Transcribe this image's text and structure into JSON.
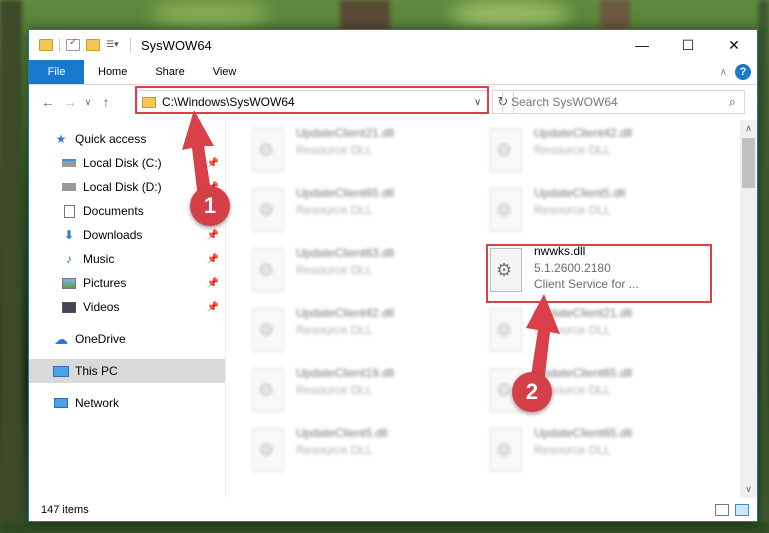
{
  "window": {
    "title": "SysWOW64",
    "controls": {
      "minimize": "—",
      "maximize": "☐",
      "close": "✕"
    }
  },
  "ribbon": {
    "file_tab": "File",
    "tabs": [
      "Home",
      "Share",
      "View"
    ],
    "help": "?"
  },
  "nav": {
    "back": "←",
    "forward": "→",
    "recent": "∨",
    "up": "↑",
    "address": "C:\\Windows\\SysWOW64",
    "search_placeholder": "Search SysWOW64"
  },
  "sidebar": {
    "items": [
      {
        "label": "Quick access",
        "icon": "star-icon",
        "pinned": false
      },
      {
        "label": "Local Disk (C:)",
        "icon": "drive-icon",
        "pinned": true
      },
      {
        "label": "Local Disk (D:)",
        "icon": "drive-icon",
        "pinned": true
      },
      {
        "label": "Documents",
        "icon": "document-icon",
        "pinned": true
      },
      {
        "label": "Downloads",
        "icon": "download-icon",
        "pinned": true
      },
      {
        "label": "Music",
        "icon": "music-icon",
        "pinned": true
      },
      {
        "label": "Pictures",
        "icon": "picture-icon",
        "pinned": true
      },
      {
        "label": "Videos",
        "icon": "video-icon",
        "pinned": true
      },
      {
        "label": "OneDrive",
        "icon": "cloud-icon",
        "pinned": false
      },
      {
        "label": "This PC",
        "icon": "computer-icon",
        "pinned": false,
        "selected": true
      },
      {
        "label": "Network",
        "icon": "network-icon",
        "pinned": false
      }
    ]
  },
  "files": [
    {
      "name": "UpdateClient21.dll",
      "desc": "Resource DLL"
    },
    {
      "name": "UpdateClient42.dll",
      "desc": "Resource DLL"
    },
    {
      "name": "UpdateClient65.dll",
      "desc": "Resource DLL"
    },
    {
      "name": "UpdateClient5.dll",
      "desc": "Resource DLL"
    },
    {
      "name": "UpdateClient63.dll",
      "desc": "Resource DLL"
    },
    {
      "name": "nwwks.dll",
      "version": "5.1.2600.2180",
      "desc": "Client Service for ...",
      "highlighted": true
    },
    {
      "name": "UpdateClient42.dll",
      "desc": "Resource DLL"
    },
    {
      "name": "UpdateClient21.dll",
      "desc": "Resource DLL"
    },
    {
      "name": "UpdateClient19.dll",
      "desc": "Resource DLL"
    },
    {
      "name": "UpdateClient65.dll",
      "desc": "Resource DLL"
    },
    {
      "name": "UpdateClient5.dll",
      "desc": "Resource DLL"
    },
    {
      "name": "UpdateClient65.dll",
      "desc": "Resource DLL"
    }
  ],
  "status": {
    "item_count": "147 items"
  },
  "annotations": {
    "badge1": "1",
    "badge2": "2",
    "color": "#d9404a"
  }
}
